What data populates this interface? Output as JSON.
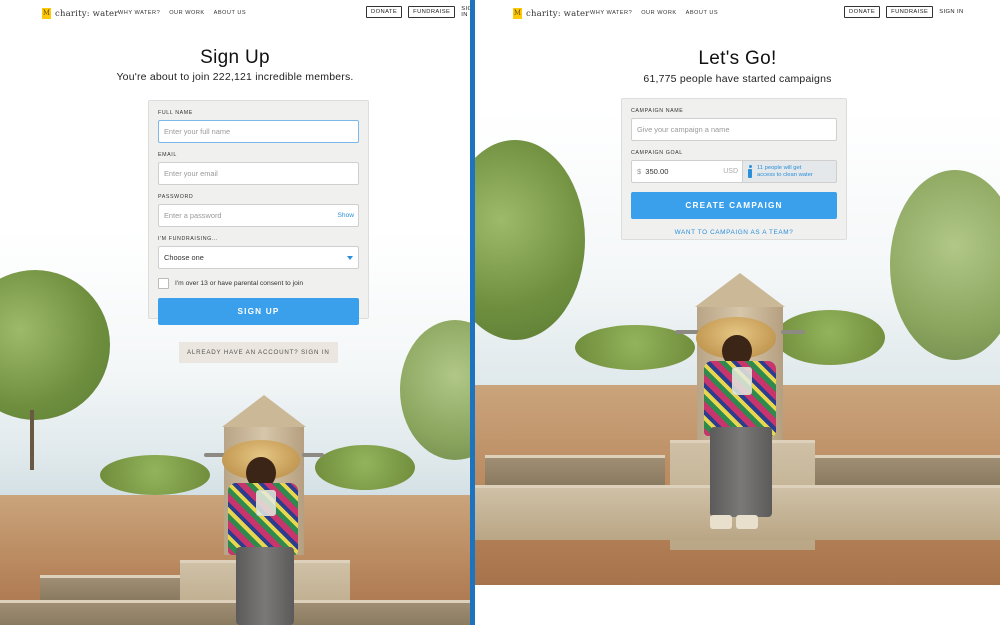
{
  "brand": {
    "logo_text": "charity: water",
    "logo_mark": "M",
    "accent_color": "#ffc907",
    "primary_color": "#3aa0ec",
    "link_color": "#2a8fdb"
  },
  "nav": {
    "links": [
      "WHY WATER?",
      "OUR WORK",
      "ABOUT US"
    ],
    "donate_label": "DONATE",
    "fundraise_label": "FUNDRAISE",
    "signin_label": "SIGN IN"
  },
  "signup": {
    "title": "Sign Up",
    "subtitle": "You're about to join 222,121 incredible members.",
    "full_name": {
      "label": "FULL NAME",
      "placeholder": "Enter your full name"
    },
    "email": {
      "label": "EMAIL",
      "placeholder": "Enter your email"
    },
    "password": {
      "label": "PASSWORD",
      "placeholder": "Enter a password",
      "show_label": "Show"
    },
    "fundraising": {
      "label": "I'M FUNDRAISING...",
      "selected": "Choose one"
    },
    "consent_label": "I'm over 13 or have parental consent to join",
    "submit_label": "SIGN UP",
    "signin_link": "ALREADY HAVE AN ACCOUNT? SIGN IN"
  },
  "campaign": {
    "title": "Let's Go!",
    "subtitle": "61,775 people have started campaigns",
    "name": {
      "label": "CAMPAIGN NAME",
      "placeholder": "Give your campaign a name"
    },
    "goal": {
      "label": "CAMPAIGN GOAL",
      "currency_symbol": "$",
      "value": "350.00",
      "currency": "USD",
      "impact_line1": "11 people will get",
      "impact_line2": "access to clean water"
    },
    "submit_label": "CREATE CAMPAIGN",
    "team_link": "WANT TO CAMPAIGN AS A TEAM?"
  }
}
